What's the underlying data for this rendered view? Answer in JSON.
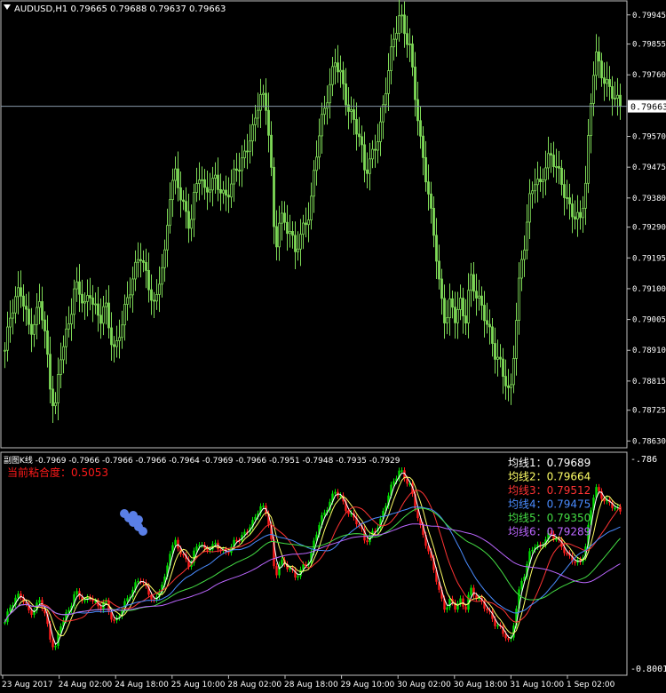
{
  "symbol_header": "AUDUSD,H1  0.79665 0.79688 0.79637 0.79663",
  "main_chart": {
    "price_ticks": [
      "0.79945",
      "0.79855",
      "0.79760",
      "0.79570",
      "0.79475",
      "0.79380",
      "0.79290",
      "0.79195",
      "0.79100",
      "0.79005",
      "0.78910",
      "0.78815",
      "0.78725",
      "0.78630"
    ],
    "current_price": "0.79663",
    "colors": {
      "up_candle": "#7ED957",
      "down_candle": "#7ED957",
      "grid": "#1a1a1a",
      "price_line": "#8899aa"
    }
  },
  "indicator": {
    "header": "副图K线 -0.7969 -0.7966 -0.7966 -0.7966 -0.7964 -0.7969 -0.7966 -0.7951 -0.7948 -0.7935 -0.7929",
    "top_tick": "-.786",
    "bottom_tick": "-0.8001",
    "sticky_label": "当前粘合度：0.5053",
    "ma_labels": [
      {
        "text": "均线1：0.79689",
        "color": "#FFFFFF"
      },
      {
        "text": "均线2：0.79664",
        "color": "#FFFF66"
      },
      {
        "text": "均线3：0.79512",
        "color": "#FF3333"
      },
      {
        "text": "均线4：0.79475",
        "color": "#4A8CFF"
      },
      {
        "text": "均线5：0.79350",
        "color": "#44DD44"
      },
      {
        "text": "均线6：0.79289",
        "color": "#BB66FF"
      }
    ],
    "colors": {
      "bull": "#00DD00",
      "bear": "#FF1A1A",
      "cluster": "#5A7FE6"
    }
  },
  "time_ticks": [
    "23 Aug 2017",
    "24 Aug 02:00",
    "24 Aug 18:00",
    "25 Aug 10:00",
    "28 Aug 02:00",
    "28 Aug 18:00",
    "29 Aug 10:00",
    "30 Aug 02:00",
    "30 Aug 18:00",
    "31 Aug 10:00",
    "1 Sep 02:00"
  ],
  "chart_data": {
    "type": "candlestick",
    "title": "AUDUSD,H1",
    "ylim": [
      0.7862,
      0.7998
    ],
    "close_path": [
      0.7891,
      0.79,
      0.7905,
      0.791,
      0.7905,
      0.7898,
      0.79,
      0.7906,
      0.7895,
      0.788,
      0.7872,
      0.789,
      0.7895,
      0.79,
      0.791,
      0.7908,
      0.7905,
      0.791,
      0.7905,
      0.79,
      0.7905,
      0.7895,
      0.789,
      0.7898,
      0.7905,
      0.791,
      0.7915,
      0.792,
      0.7915,
      0.791,
      0.7905,
      0.7915,
      0.792,
      0.7938,
      0.7945,
      0.794,
      0.7935,
      0.793,
      0.794,
      0.7945,
      0.7938,
      0.7942,
      0.7945,
      0.7942,
      0.7938,
      0.794,
      0.7945,
      0.7948,
      0.7952,
      0.7958,
      0.7962,
      0.797,
      0.7966,
      0.7955,
      0.792,
      0.7935,
      0.793,
      0.7928,
      0.792,
      0.7925,
      0.793,
      0.7935,
      0.795,
      0.796,
      0.7965,
      0.7972,
      0.798,
      0.7978,
      0.797,
      0.7965,
      0.796,
      0.7955,
      0.7945,
      0.795,
      0.7955,
      0.796,
      0.797,
      0.798,
      0.7988,
      0.7995,
      0.799,
      0.7985,
      0.797,
      0.7955,
      0.7945,
      0.7935,
      0.7925,
      0.791,
      0.79,
      0.7905,
      0.79,
      0.7905,
      0.79,
      0.7915,
      0.791,
      0.7905,
      0.79,
      0.7895,
      0.789,
      0.7888,
      0.7883,
      0.7876,
      0.7895,
      0.7915,
      0.7925,
      0.794,
      0.7945,
      0.7942,
      0.7947,
      0.795,
      0.7948,
      0.7945,
      0.794,
      0.7935,
      0.7932,
      0.793,
      0.794,
      0.7965,
      0.7985,
      0.7978,
      0.7974,
      0.797,
      0.7968,
      0.79663
    ]
  }
}
